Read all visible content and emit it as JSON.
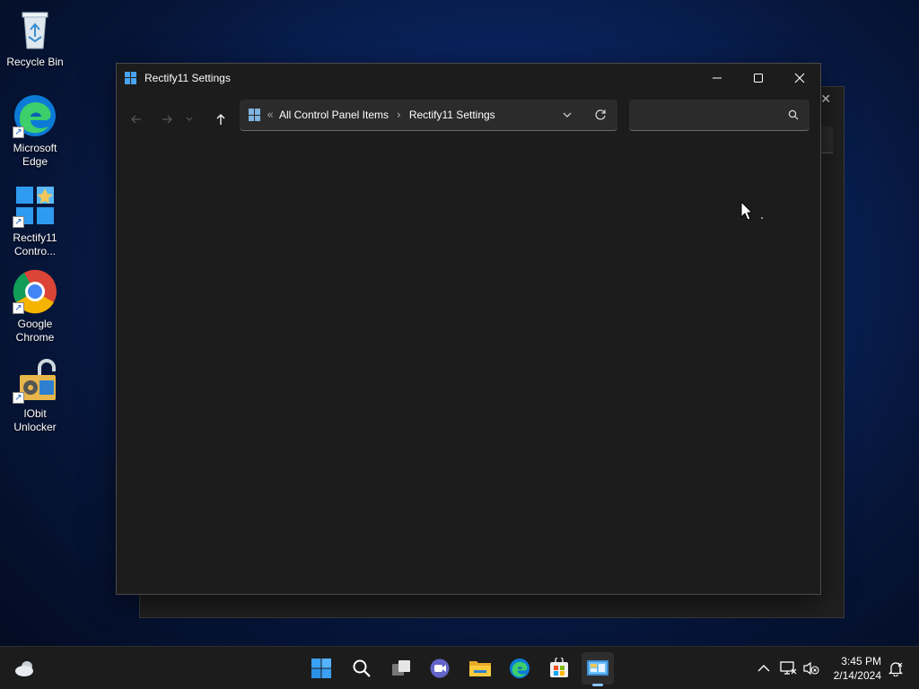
{
  "desktop": {
    "icons": [
      {
        "label": "Recycle Bin",
        "icon": "recycle-bin-icon"
      },
      {
        "label": "Microsoft Edge",
        "icon": "edge-icon"
      },
      {
        "label": "Rectify11 Contro...",
        "icon": "control-panel-icon"
      },
      {
        "label": "Google Chrome",
        "icon": "chrome-icon"
      },
      {
        "label": "IObit Unlocker",
        "icon": "iobit-unlocker-icon"
      }
    ]
  },
  "window": {
    "title": "Rectify11 Settings",
    "address": {
      "overflow": "«",
      "crumbs": [
        "All Control Panel Items",
        "Rectify11 Settings"
      ],
      "separator": "›"
    },
    "search": {
      "placeholder": "",
      "value": ""
    }
  },
  "taskbar": {
    "apps": [
      "weather-icon",
      "start-icon",
      "search-icon",
      "task-view-icon",
      "teams-chat-icon",
      "file-explorer-icon",
      "edge-icon",
      "microsoft-store-icon",
      "control-panel-icon"
    ],
    "clock": {
      "time": "3:45 PM",
      "date": "2/14/2024"
    }
  },
  "colors": {
    "accent": "#4aa3f0",
    "window_bg": "#1c1c1c",
    "taskbar_bg": "#1c1c1c"
  }
}
